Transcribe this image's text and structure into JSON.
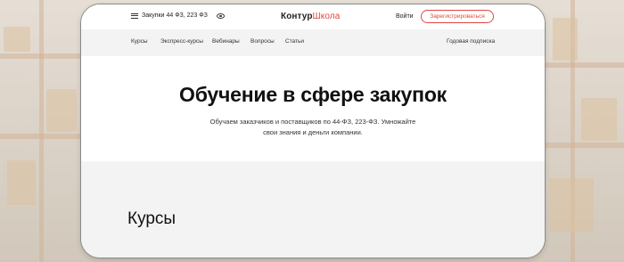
{
  "header": {
    "topic": "Закупки 44 ФЗ, 223 ФЗ",
    "logo_part1": "Контур",
    "logo_part2": "Школа",
    "login": "Войти",
    "register": "Зарегистрироваться"
  },
  "nav": {
    "items": [
      "Курсы",
      "Экспресс-курсы",
      "Вебинары",
      "Вопросы",
      "Статьи"
    ],
    "subscription": "Годовая подписка"
  },
  "hero": {
    "title": "Обучение в сфере закупок",
    "subtitle": "Обучаем заказчиков и поставщиков по 44-ФЗ, 223-ФЗ. Умножайте свои знания и деньги компании."
  },
  "courses": {
    "title": "Курсы"
  },
  "colors": {
    "accent": "#e0473f",
    "nav_bg": "#f3f3f3"
  }
}
